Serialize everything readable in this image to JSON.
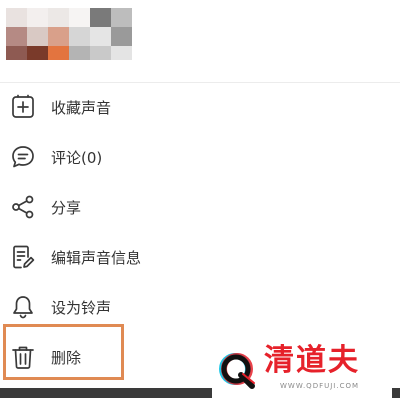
{
  "colors": {
    "icon": "#3a3a3a",
    "text": "#333333",
    "highlight": "#e08a53",
    "watermark_red": "#e6212a",
    "watermark_cyan": "#1ec8e6"
  },
  "header": {
    "avatar_blurred": true
  },
  "menu": {
    "items": [
      {
        "icon": "add-square-icon",
        "label": "收藏声音"
      },
      {
        "icon": "comment-icon",
        "label": "评论(0)"
      },
      {
        "icon": "share-icon",
        "label": "分享"
      },
      {
        "icon": "edit-document-icon",
        "label": "编辑声音信息"
      },
      {
        "icon": "bell-icon",
        "label": "设为铃声"
      },
      {
        "icon": "trash-icon",
        "label": "删除"
      }
    ]
  },
  "watermark": {
    "brand": "清道夫",
    "url": "WWW.QDFUJI.COM"
  }
}
